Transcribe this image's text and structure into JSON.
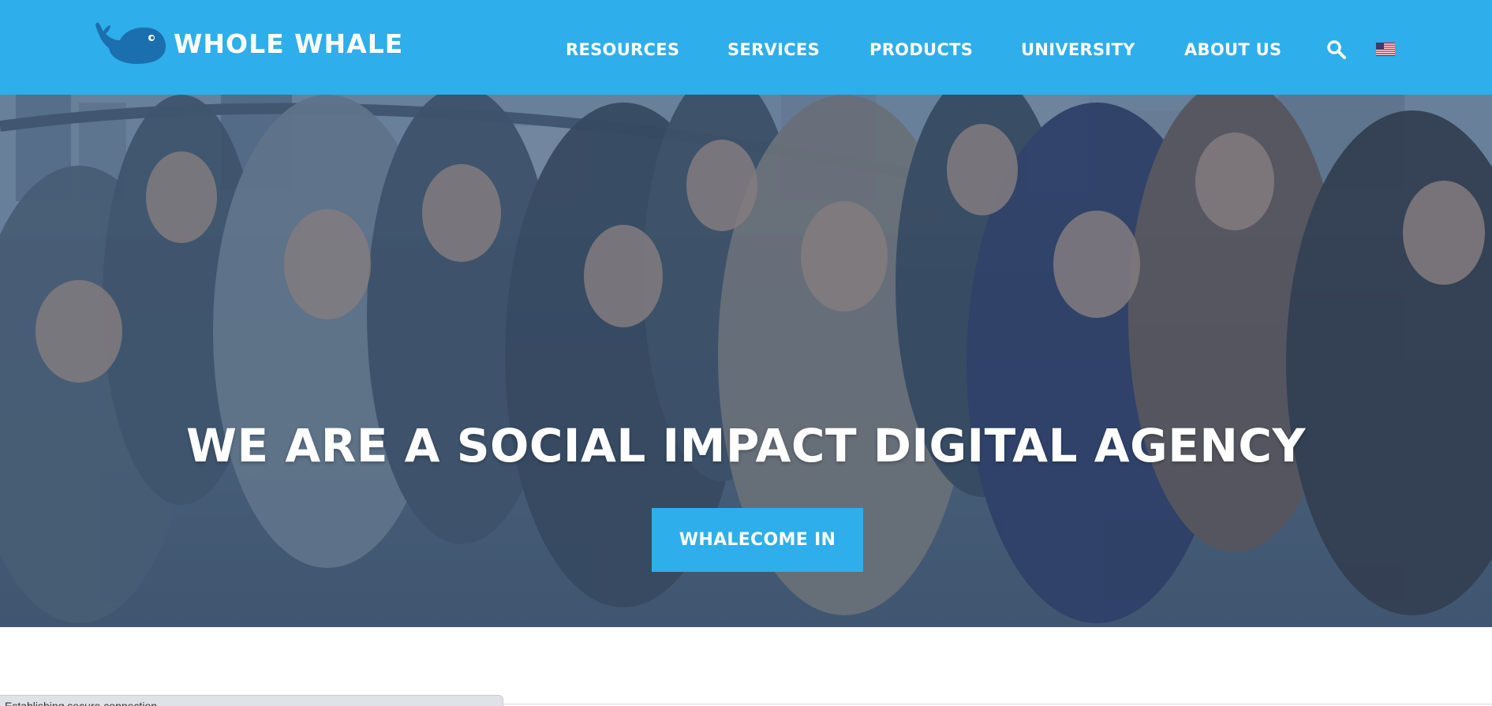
{
  "header": {
    "brand": "WHOLE WHALE",
    "brand_color": "#2eaeea",
    "logo_icon": "whale-icon"
  },
  "nav": {
    "items": [
      {
        "label": "RESOURCES"
      },
      {
        "label": "SERVICES"
      },
      {
        "label": "PRODUCTS"
      },
      {
        "label": "UNIVERSITY"
      },
      {
        "label": "ABOUT US"
      }
    ],
    "search_icon": "search-icon",
    "language_icon": "us-flag-icon"
  },
  "hero": {
    "title": "WE ARE A SOCIAL IMPACT DIGITAL AGENCY",
    "cta_label": "WHALECOME IN",
    "image_description": "team photo in front of city skyline and bridge"
  },
  "status": {
    "text": "Establishing secure connection..."
  }
}
